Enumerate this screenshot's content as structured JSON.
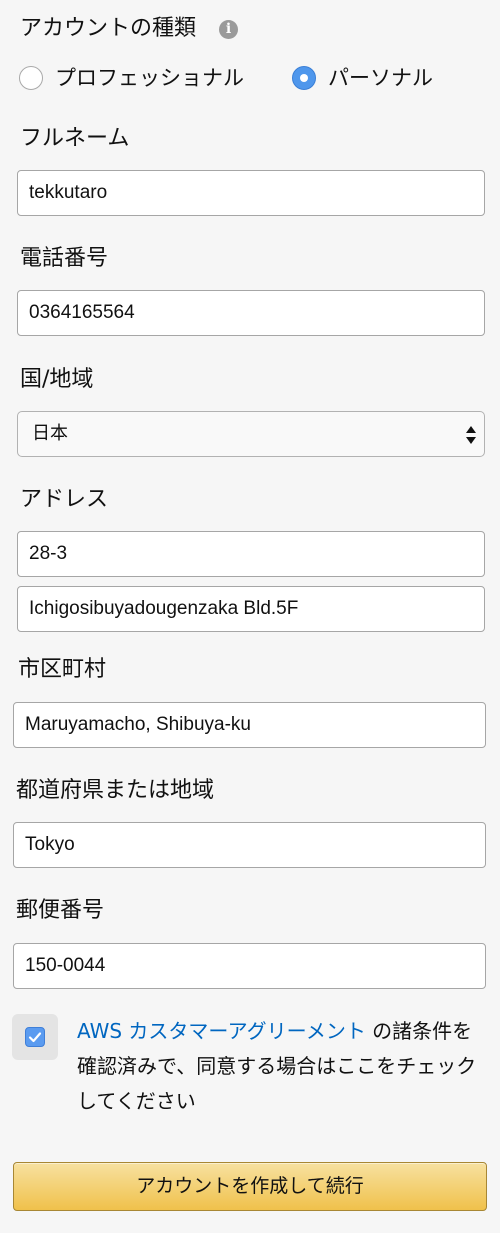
{
  "account_type": {
    "label": "アカウントの種類",
    "info_icon": "info-icon",
    "options": [
      {
        "label": "プロフェッショナル",
        "selected": false
      },
      {
        "label": "パーソナル",
        "selected": true
      }
    ]
  },
  "full_name": {
    "label": "フルネーム",
    "value": "tekkutaro"
  },
  "phone": {
    "label": "電話番号",
    "value": "0364165564"
  },
  "country": {
    "label": "国/地域",
    "selected": "日本",
    "icon": "select-arrows-icon"
  },
  "address": {
    "label": "アドレス",
    "line1": "28-3",
    "line2": "Ichigosibuyadougenzaka Bld.5F"
  },
  "city": {
    "label": "市区町村",
    "value": "Maruyamacho, Shibuya-ku"
  },
  "state": {
    "label": "都道府県または地域",
    "value": "Tokyo"
  },
  "postal": {
    "label": "郵便番号",
    "value": "150-0044"
  },
  "agreement": {
    "checked": true,
    "link_text": "AWS カスタマーアグリーメント",
    "text": " の諸条件を確認済みで、同意する場合はここをチェックしてください"
  },
  "submit": {
    "label": "アカウントを作成して続行"
  },
  "colors": {
    "link": "#0066c0",
    "radio_selected": "#4f97ec",
    "button": "#f0c14b",
    "background": "#f6f6f6"
  }
}
